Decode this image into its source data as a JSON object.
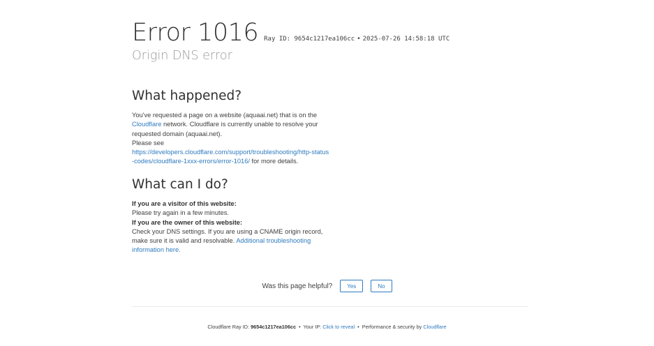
{
  "header": {
    "title": "Error 1016",
    "ray_label": "Ray ID: 9654c1217ea106cc",
    "separator": "•",
    "timestamp": "2025-07-26 14:58:18 UTC",
    "subtitle": "Origin DNS error"
  },
  "what_happened": {
    "heading": "What happened?",
    "text_1": "You've requested a page on a website (aquaai.net) that is on the ",
    "cloudflare_link": "Cloudflare",
    "text_2": " network. Cloudflare is currently unable to resolve your requested domain (aquaai.net).",
    "please_see": "Please see",
    "doc_link": "https://developers.cloudflare.com/support/troubleshooting/http-status-codes/cloudflare-1xxx-errors/error-1016/",
    "text_3": " for more details."
  },
  "what_can_i_do": {
    "heading": "What can I do?",
    "visitor_label": "If you are a visitor of this website:",
    "visitor_text": "Please try again in a few minutes.",
    "owner_label": "If you are the owner of this website:",
    "owner_text": "Check your DNS settings. If you are using a CNAME origin record, make sure it is valid and resolvable. ",
    "troubleshoot_link": "Additional troubleshooting information here."
  },
  "feedback": {
    "question": "Was this page helpful?",
    "yes_label": "Yes",
    "no_label": "No"
  },
  "footer": {
    "ray_prefix": "Cloudflare Ray ID: ",
    "ray_id": "9654c1217ea106cc",
    "sep1": "•",
    "ip_prefix": "Your IP: ",
    "ip_link": "Click to reveal",
    "sep2": "•",
    "perf_prefix": "Performance & security by ",
    "cf_link": "Cloudflare"
  },
  "colors": {
    "link": "#2f7bbf",
    "heading": "#313131",
    "subtitle": "#999999",
    "text": "#404040"
  }
}
